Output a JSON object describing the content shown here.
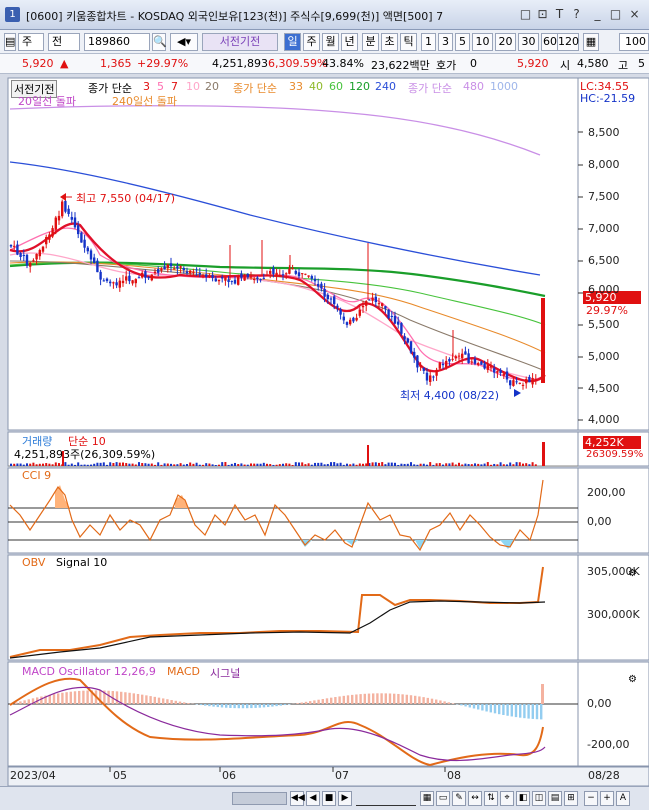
{
  "titlebar": {
    "app_number": "1",
    "title": "[0600] 키움종합차트 - KOSDAQ 외국인보유[123(천)] 주식수[9,699(천)] 액면[500] 7",
    "buttons": [
      "□",
      "⊡",
      "T",
      "?",
      "_",
      "□",
      "×"
    ]
  },
  "toolbar": {
    "period_select": "주",
    "period_select2": "전",
    "code_value": "189860",
    "stock_name": "서전기전",
    "timeframes": [
      "일",
      "주",
      "월",
      "년",
      "분",
      "초",
      "틱"
    ],
    "intervals": [
      "1",
      "3",
      "5",
      "10",
      "20",
      "30",
      "60",
      "120"
    ],
    "count_value": "100"
  },
  "pricestrip": {
    "price": "5,920",
    "change": "1,365",
    "change_pct": "+29.97%",
    "volume": "4,251,893",
    "volume_ratio": "6,309.59%",
    "turnover": "43.84%",
    "amount": "23,622백만",
    "quote_label": "호가",
    "quote_value": "0",
    "cur_price": "5,920",
    "open_label": "시",
    "open_value": "4,580",
    "high_label": "고",
    "high_value": "5"
  },
  "price_panel": {
    "name_tag": "서전기전",
    "legend_price": "종가 단순",
    "ma_short": [
      "3",
      "5",
      "7",
      "10",
      "20"
    ],
    "legend_price2": "종가 단순",
    "ma_long": [
      "33",
      "40",
      "60",
      "120",
      "240"
    ],
    "legend_price3": "종가 단순",
    "ma_480": "480",
    "ma_1000": "1000",
    "cross20": "20일선 돌파",
    "cross240": "240일선 돌파",
    "lc": "LC:34.55",
    "hc": "HC:-21.59",
    "high_note": "최고 7,550 (04/17)",
    "low_note": "최저 4,400 (08/22)",
    "price_tag": "5,920",
    "pct_tag": "29.97%",
    "axis": [
      "8,500",
      "8,000",
      "7,500",
      "7,000",
      "6,500",
      "6,000",
      "5,500",
      "5,000",
      "4,500",
      "4,000"
    ]
  },
  "volume_panel": {
    "label": "거래량",
    "sub": "단순 10",
    "value": "4,251,893주(26,309.59%)",
    "tag1": "4,252K",
    "tag2": "26309.59%"
  },
  "cci_panel": {
    "label": "CCI 9",
    "axis": [
      "200,00",
      "0,00"
    ]
  },
  "obv_panel": {
    "label": "OBV",
    "signal": "Signal 10",
    "axis": [
      "305,000K",
      "300,000K"
    ]
  },
  "macd_panel": {
    "label": "MACD Oscillator 12,26,9",
    "macd": "MACD",
    "signal": "시그널",
    "axis": [
      "0,00",
      "-200,00"
    ]
  },
  "x_axis": [
    "2023/04",
    "05",
    "06",
    "07",
    "08",
    "08/28"
  ],
  "colors": {
    "up": "#e01010",
    "down": "#1433c8",
    "ma240": "#2a52d6",
    "ma120": "#1a9e2a",
    "ma480": "#c87be0"
  }
}
